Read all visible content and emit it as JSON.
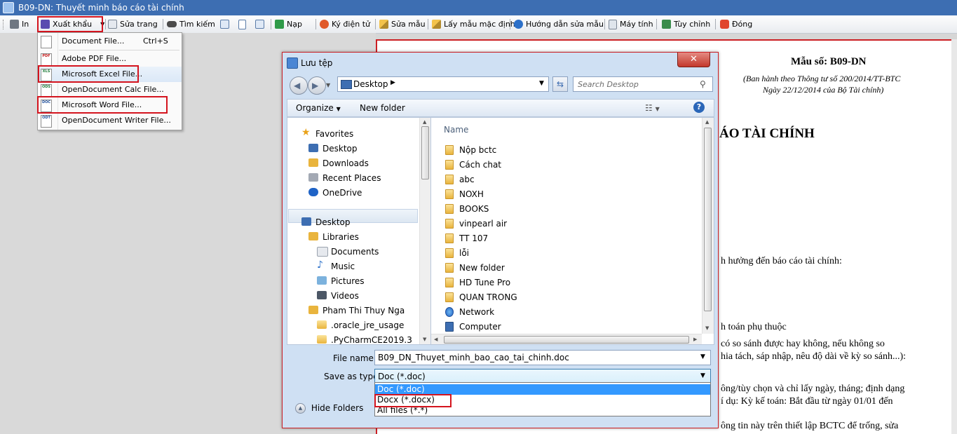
{
  "window": {
    "title": "B09-DN: Thuyết minh báo cáo tài chính"
  },
  "toolbar": {
    "print": "In",
    "export": "Xuất khẩu",
    "edit_page": "Sửa trang",
    "find": "Tìm kiếm",
    "load": "Nạp",
    "signer": "Ký điện tử",
    "edit_template": "Sửa mẫu",
    "default_template": "Lấy mẫu mặc định",
    "template_help": "Hướng dẫn sửa mẫu",
    "calculator": "Máy tính",
    "options": "Tùy chỉnh",
    "close": "Đóng"
  },
  "export_menu": {
    "items": [
      {
        "label": "Document File...",
        "shortcut": "Ctrl+S",
        "icon": "document-file-icon"
      },
      {
        "label": "Adobe PDF File...",
        "shortcut": "",
        "icon": "pdf-file-icon",
        "tag": "PDF"
      },
      {
        "label": "Microsoft Excel File...",
        "shortcut": "",
        "icon": "excel-file-icon",
        "tag": "XLS"
      },
      {
        "label": "OpenDocument Calc File...",
        "shortcut": "",
        "icon": "ods-file-icon",
        "tag": "ODS"
      },
      {
        "label": "Microsoft Word File...",
        "shortcut": "",
        "icon": "word-file-icon",
        "tag": "DOC"
      },
      {
        "label": "OpenDocument Writer File...",
        "shortcut": "",
        "icon": "odt-file-icon",
        "tag": "ODT"
      }
    ]
  },
  "document": {
    "form_no": "Mẫu số: B09-DN",
    "issued_by": "(Ban hành theo Thông tư số 200/2014/TT-BTC",
    "issued_date": "Ngày 22/12/2014 của Bộ Tài chính)",
    "heading_fragment": "ÁO TÀI CHÍNH",
    "line_1": "h hưởng đến báo cáo tài chính:",
    "line_2": "h toán phụ thuộc",
    "line_3": "có so sánh được hay không, nếu không so",
    "line_4": "hia tách, sáp nhập, nêu độ dài về kỳ so sánh...):",
    "line_5": "ông/tùy chọn và chỉ lấy ngày, tháng; định dạng",
    "line_6": "í dụ: Kỳ kế toán: Bắt đầu từ ngày 01/01 đến",
    "line_7": "ông tin này trên thiết lập BCTC để trống, sửa"
  },
  "dialog": {
    "title": "Lưu tệp",
    "address": "Desktop",
    "search_placeholder": "Search Desktop",
    "organize": "Organize",
    "new_folder": "New folder",
    "nav_items": [
      {
        "label": "Favorites",
        "icon": "star-icon"
      },
      {
        "label": "Desktop",
        "icon": "desktop-icon"
      },
      {
        "label": "Downloads",
        "icon": "downloads-icon"
      },
      {
        "label": "Recent Places",
        "icon": "recent-places-icon"
      },
      {
        "label": "OneDrive",
        "icon": "onedrive-icon"
      },
      {
        "label": "Desktop",
        "icon": "desktop-icon"
      },
      {
        "label": "Libraries",
        "icon": "libraries-icon"
      },
      {
        "label": "Documents",
        "icon": "documents-icon"
      },
      {
        "label": "Music",
        "icon": "music-icon"
      },
      {
        "label": "Pictures",
        "icon": "pictures-icon"
      },
      {
        "label": "Videos",
        "icon": "videos-icon"
      },
      {
        "label": "Pham Thi Thuy Nga",
        "icon": "user-folder-icon"
      },
      {
        "label": ".oracle_jre_usage",
        "icon": "folder-icon"
      },
      {
        "label": ".PyCharmCE2019.3",
        "icon": "folder-icon"
      }
    ],
    "column_name": "Name",
    "files": [
      {
        "label": "Nộp bctc",
        "icon": "folder-icon"
      },
      {
        "label": "Cách chat",
        "icon": "folder-icon"
      },
      {
        "label": "abc",
        "icon": "folder-icon"
      },
      {
        "label": "NOXH",
        "icon": "folder-icon"
      },
      {
        "label": "BOOKS",
        "icon": "folder-icon"
      },
      {
        "label": "vinpearl air",
        "icon": "folder-icon"
      },
      {
        "label": "TT 107",
        "icon": "folder-icon"
      },
      {
        "label": "lỗi",
        "icon": "folder-icon"
      },
      {
        "label": "New folder",
        "icon": "folder-icon"
      },
      {
        "label": "HD Tune Pro",
        "icon": "folder-icon"
      },
      {
        "label": "QUAN TRONG",
        "icon": "folder-icon"
      },
      {
        "label": "Network",
        "icon": "network-icon"
      },
      {
        "label": "Computer",
        "icon": "computer-icon"
      }
    ],
    "file_name_label": "File name:",
    "file_name_value": "B09_DN_Thuyet_minh_bao_cao_tai_chinh.doc",
    "save_type_label": "Save as type:",
    "save_type_value": "Doc (*.doc)",
    "save_type_options": [
      "Doc (*.doc)",
      "Docx (*.docx)",
      "All files (*.*)"
    ],
    "hide_folders": "Hide Folders"
  },
  "colors": {
    "title_bar": "#3d6eb2",
    "highlight_red": "#d4141e",
    "selection_blue": "#3399ff"
  }
}
